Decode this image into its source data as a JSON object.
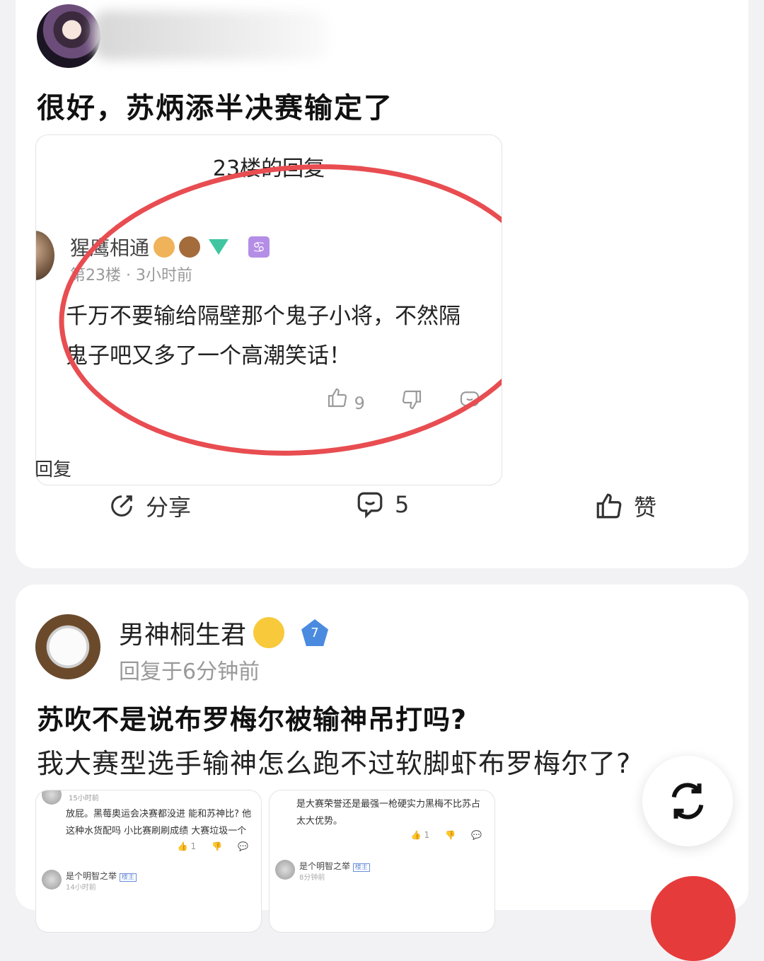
{
  "post1": {
    "title": "很好，苏炳添半决赛输定了",
    "embedded": {
      "header": "23楼的回复",
      "username": "猩鹰相通",
      "sign_badge": "♋",
      "meta": "第23楼  ·  3小时前",
      "text_line1": "千万不要输给隔壁那个鬼子小将，不然隔",
      "text_line2": "鬼子吧又多了一个高潮笑话！",
      "like_count": "9",
      "reply_label": "回复"
    },
    "actions": {
      "share_label": "分享",
      "comment_count": "5",
      "like_label": "赞"
    }
  },
  "post2": {
    "username": "男神桐生君",
    "level": "7",
    "time": "回复于6分钟前",
    "title": "苏吹不是说布罗梅尔被输神吊打吗?",
    "body": "我大赛型选手输神怎么跑不过软脚虾布罗梅尔了?",
    "image1": {
      "time": "15小时前",
      "text": "放屁。黑莓奥运会决赛都没进 能和苏神比? 他这种水货配吗 小比赛刷刷成绩 大赛垃圾一个",
      "like_count": "1",
      "user": "是个明智之举",
      "user_tag": "楼主",
      "sub": "14小时前"
    },
    "image2": {
      "text": "是大赛荣誉还是最强一枪硬实力黑梅不比苏占太大优势。",
      "like_count": "1",
      "user": "是个明智之举",
      "user_tag": "楼主",
      "sub": "8分钟前"
    }
  },
  "colors": {
    "accent_red": "#e84d51",
    "fab_red": "#e63b3b",
    "text_muted": "#999999"
  },
  "icons": [
    "share-icon",
    "comment-icon",
    "thumbs-up-icon",
    "thumbs-down-icon",
    "refresh-icon"
  ]
}
